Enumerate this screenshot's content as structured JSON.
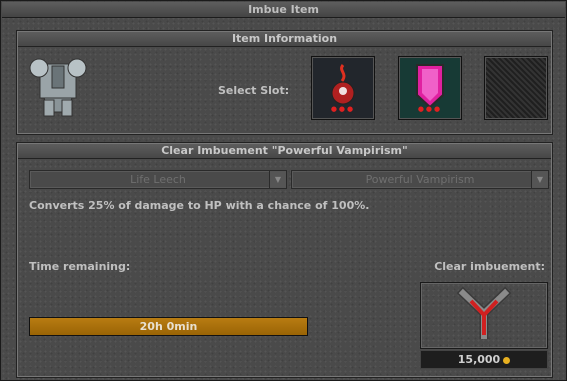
{
  "window": {
    "title": "Imbue Item"
  },
  "item_info": {
    "header": "Item Information",
    "select_slot_label": "Select Slot:",
    "slots": [
      {
        "name": "life-leech-slot",
        "dots": "●●●"
      },
      {
        "name": "pink-shield-slot",
        "dots": "●●●"
      },
      {
        "name": "empty-slot",
        "dots": ""
      }
    ]
  },
  "clear": {
    "header": "Clear Imbuement \"Powerful Vampirism\"",
    "dropdown_type": "Life Leech",
    "dropdown_level": "Powerful Vampirism",
    "description": "Converts 25% of damage to HP with a chance of 100%.",
    "time_label": "Time remaining:",
    "time_value": "20h 0min",
    "clear_label": "Clear imbuement:",
    "cost": "15,000"
  }
}
